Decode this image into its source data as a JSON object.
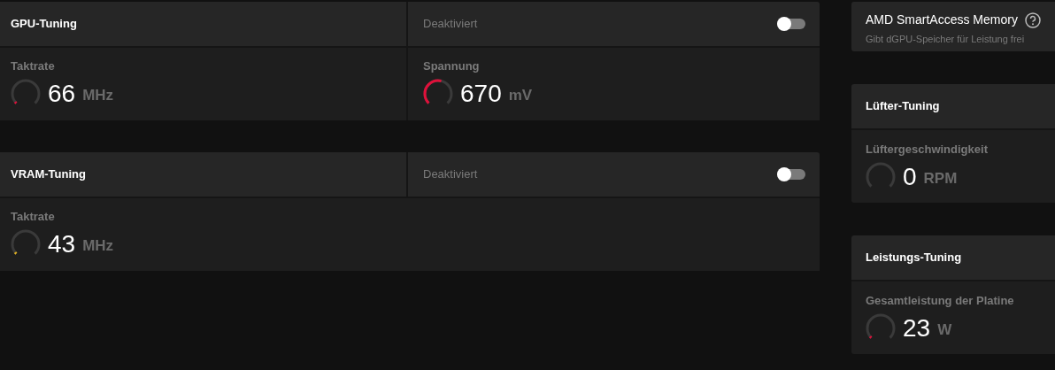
{
  "panels": [
    {
      "title": "GPU-Tuning",
      "status": "Deaktiviert",
      "toggle_on": false,
      "metrics": [
        {
          "label": "Taktrate",
          "value": "66",
          "unit": "MHz"
        },
        {
          "label": "Spannung",
          "value": "670",
          "unit": "mV"
        }
      ]
    },
    {
      "title": "VRAM-Tuning",
      "status": "Deaktiviert",
      "toggle_on": false,
      "metrics": [
        {
          "label": "Taktrate",
          "value": "43",
          "unit": "MHz"
        }
      ]
    }
  ],
  "smart_access": {
    "title": "AMD SmartAccess Memory",
    "subtitle": "Gibt dGPU-Speicher für Leistung frei"
  },
  "side_panels": [
    {
      "title": "Lüfter-Tuning",
      "metrics": [
        {
          "label": "Lüftergeschwindigkeit",
          "value": "0",
          "unit": "RPM"
        }
      ]
    },
    {
      "title": "Leistungs-Tuning",
      "metrics": [
        {
          "label": "Gesamtleistung der Platine",
          "value": "23",
          "unit": "W"
        }
      ]
    }
  ]
}
